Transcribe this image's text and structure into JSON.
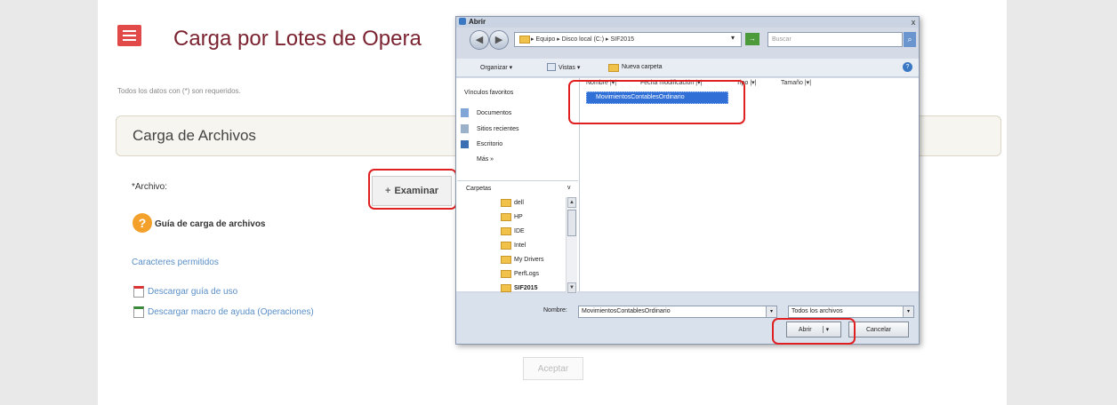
{
  "page": {
    "title": "Carga por Lotes de Opera",
    "required_note": "Todos los datos con (*) son requeridos.",
    "panel_title": "Carga de Archivos",
    "file_label": "*Archivo:",
    "examinar_label": "Examinar",
    "examinar_icon": "+",
    "help_title": "Guía de carga de archivos",
    "help_icon": "?",
    "link_caracteres": "Caracteres permitidos",
    "link_guia": "Descargar guía de uso",
    "link_macro": "Descargar macro de ayuda (Operaciones)",
    "accept_label": "Aceptar"
  },
  "dialog": {
    "title": "Abrir",
    "close_glyph": "x",
    "back_glyph": "◀",
    "forward_glyph": "▶",
    "address": "▸ Equipo ▸ Disco local (C:) ▸ SIF2015",
    "address_dropdown": "▾",
    "go_glyph": "→",
    "search_placeholder": "Buscar",
    "search_glyph": "⌕",
    "toolbar": {
      "organizar": "Organizar ▾",
      "vistas": "Vistas ▾",
      "nueva_carpeta": "Nueva carpeta",
      "help_glyph": "?"
    },
    "favorites_header": "Vínculos favoritos",
    "favorites": [
      "Documentos",
      "Sitios recientes",
      "Escritorio",
      "Más »"
    ],
    "folders_header": "Carpetas",
    "folders_chevron": "v",
    "folders": [
      "dell",
      "HP",
      "IDE",
      "Intel",
      "My Drivers",
      "PerfLogs",
      "SIF2015"
    ],
    "columns": [
      "Nombre",
      "Fecha modificación",
      "Tipo",
      "Tamaño"
    ],
    "column_sep": "|▾|",
    "files": [
      "MovimientosContablesOrdinario"
    ],
    "filename_label": "Nombre:",
    "filename_value": "MovimientosContablesOrdinario",
    "filetype_value": "Todos los archivos",
    "combo_arrow": "▾",
    "open_label": "Abrir",
    "open_arrow": "▾",
    "cancel_label": "Cancelar",
    "scroll_up": "▲",
    "scroll_down": "▼"
  },
  "colors": {
    "title": "#7b2331",
    "menu_icon": "#e24a4a",
    "highlight_box": "#e02020",
    "link": "#5a8fc8",
    "selection": "#2f6fd6"
  }
}
